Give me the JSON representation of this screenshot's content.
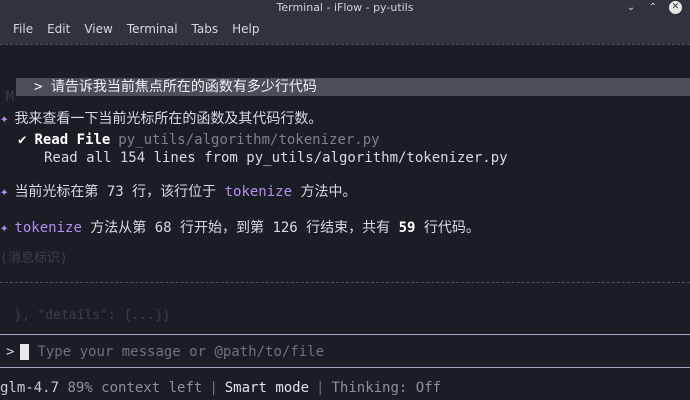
{
  "window": {
    "title": "Terminal - iFlow - py-utils",
    "minimize_glyph": "⌄",
    "maximize_glyph": "⌃",
    "close_glyph": "✕"
  },
  "menu": [
    "File",
    "Edit",
    "View",
    "Terminal",
    "Tabs",
    "Help"
  ],
  "conversation": {
    "user_prompt": "> 请告诉我当前焦点所在的函数有多少行代码",
    "assistant_intro_icon": "✦",
    "assistant_intro": "我来查看一下当前光标所在的函数及其代码行数。",
    "tool_check": "✔",
    "tool_name": "Read File",
    "tool_arg": "py_utils/algorithm/tokenizer.py",
    "tool_result": "Read all 154 lines from py_utils/algorithm/tokenizer.py",
    "answer1_pre": "当前光标在第 73 行，该行位于 ",
    "answer1_fn": "tokenize",
    "answer1_post": " 方法中。",
    "answer2_fn": "tokenize",
    "answer2_pre": " 方法从第 68 行开始，到第 126 行结束，共有 ",
    "answer2_count": "59",
    "answer2_post": " 行代码。"
  },
  "ghost": {
    "left_fragment": "M",
    "aux_fragment": "(消息标识)",
    "details_fragment": "}, \"details\": {...}}"
  },
  "input": {
    "prompt_symbol": ">",
    "placeholder": "Type your message or @path/to/file"
  },
  "status": {
    "model": "glm-4.7",
    "context": "89% context left",
    "separator": "|",
    "mode": "Smart mode",
    "thinking": "Thinking: Off"
  },
  "colors": {
    "accent": "#b48ef0",
    "background": "#1b1d24",
    "chrome": "#2f333d"
  }
}
